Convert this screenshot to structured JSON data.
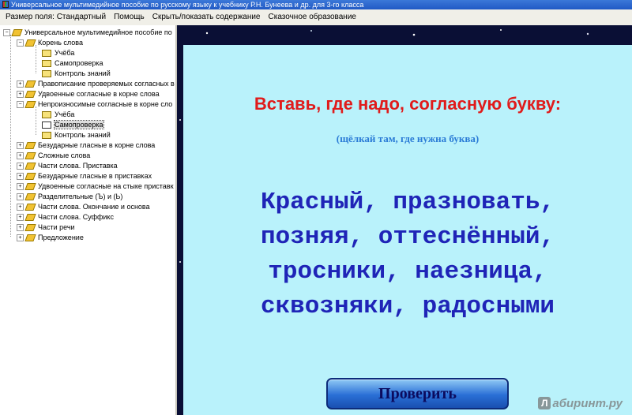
{
  "window": {
    "title": "Универсальное мультимедийное пособие по русскому языку к учебнику Р.Н. Бунеева и др. для 3-го класса"
  },
  "menu": {
    "items": [
      "Размер поля: Стандартный",
      "Помощь",
      "Скрыть/показать содержание",
      "Сказочное образование"
    ]
  },
  "tree": {
    "root": "Универсальное мультимедийное пособие по",
    "items": [
      {
        "label": "Корень слова",
        "expander": "−"
      },
      {
        "label": "Учёба"
      },
      {
        "label": "Самопроверка"
      },
      {
        "label": "Контроль знаний"
      },
      {
        "label": "Правописание проверяемых согласных в",
        "expander": "+"
      },
      {
        "label": "Удвоенные согласные в корне слова",
        "expander": "+"
      },
      {
        "label": "Непроизносимые согласные в корне сло",
        "expander": "−"
      },
      {
        "label": "Учёба"
      },
      {
        "label": "Самопроверка",
        "selected": true
      },
      {
        "label": "Контроль знаний"
      },
      {
        "label": "Безударные гласные в корне слова",
        "expander": "+"
      },
      {
        "label": "Сложные слова",
        "expander": "+"
      },
      {
        "label": "Части слова. Приставка",
        "expander": "+"
      },
      {
        "label": "Безударные гласные в приставках",
        "expander": "+"
      },
      {
        "label": "Удвоенные согласные на стыке приставк",
        "expander": "+"
      },
      {
        "label": "Разделительные (Ъ) и (Ь)",
        "expander": "+"
      },
      {
        "label": "Части слова. Окончание и основа",
        "expander": "+"
      },
      {
        "label": "Части слова. Суффикс",
        "expander": "+"
      },
      {
        "label": "Части речи",
        "expander": "+"
      },
      {
        "label": "Предложение",
        "expander": "+"
      }
    ]
  },
  "exercise": {
    "heading": "Вставь, где надо, согласную букву:",
    "hint": "(щёлкай там, где нужна буква)",
    "lines": [
      "Красный, празновать,",
      "позняя, оттеснённый,",
      "тросники, наезница,",
      "сквозняки, радосными"
    ],
    "check_label": "Проверить"
  },
  "watermark": {
    "logo": "Л",
    "text": "абиринт.ру"
  },
  "colors": {
    "heading": "#e01b1b",
    "hint": "#2a7bd6",
    "words": "#1f24b7",
    "panel": "#b9f2fb",
    "frame": "#0a0f35"
  }
}
